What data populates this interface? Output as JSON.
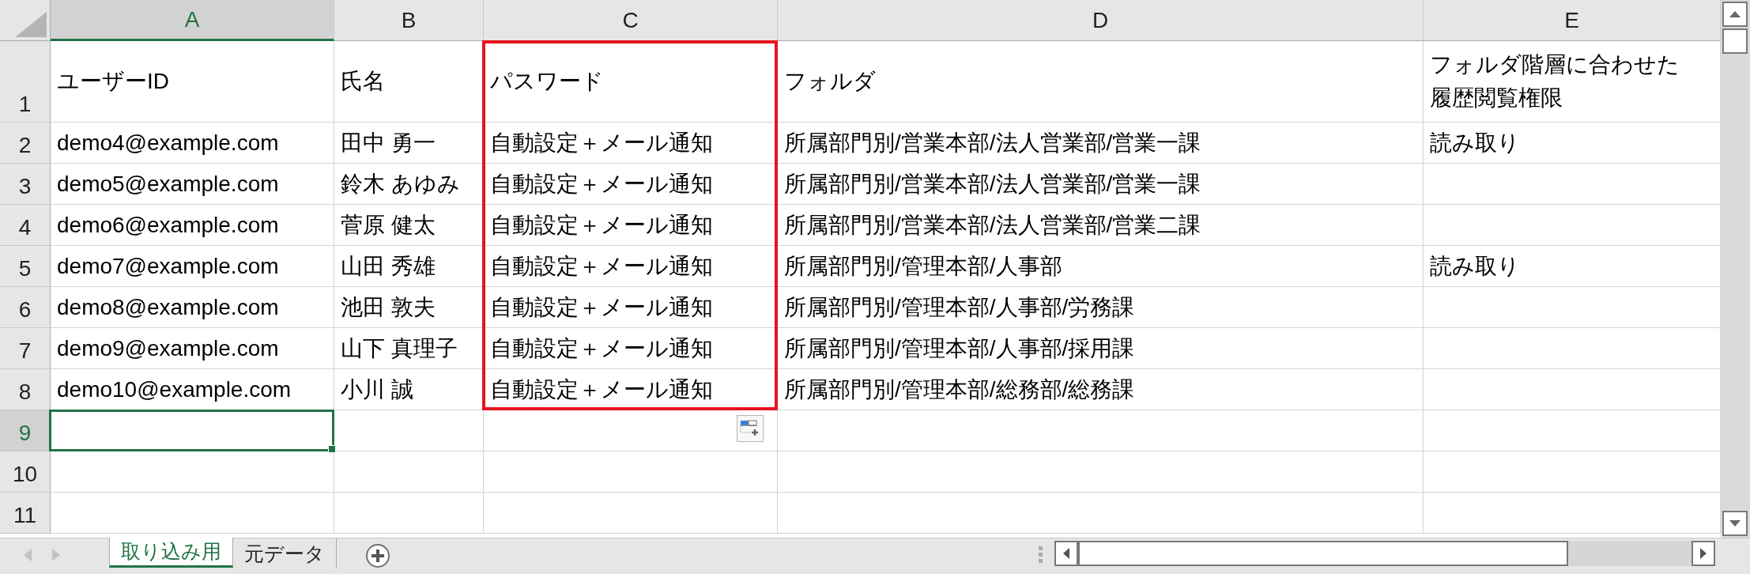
{
  "columns": [
    {
      "label": "A",
      "selected": true,
      "highlighted": false
    },
    {
      "label": "B",
      "selected": false,
      "highlighted": false
    },
    {
      "label": "C",
      "selected": false,
      "highlighted": true
    },
    {
      "label": "D",
      "selected": false,
      "highlighted": false
    },
    {
      "label": "E",
      "selected": false,
      "highlighted": false
    }
  ],
  "rows": [
    {
      "number": "1",
      "selected": false,
      "cells": [
        "ユーザーID",
        "氏名",
        "パスワード",
        "フォルダ",
        "フォルダ階層に合わせた履歴閲覧権限"
      ]
    },
    {
      "number": "2",
      "selected": false,
      "cells": [
        "demo4@example.com",
        "田中 勇一",
        "自動設定＋メール通知",
        "所属部門別/営業本部/法人営業部/営業一課",
        "読み取り"
      ]
    },
    {
      "number": "3",
      "selected": false,
      "cells": [
        "demo5@example.com",
        "鈴木 あゆみ",
        "自動設定＋メール通知",
        "所属部門別/営業本部/法人営業部/営業一課",
        null
      ]
    },
    {
      "number": "4",
      "selected": false,
      "cells": [
        "demo6@example.com",
        "菅原 健太",
        "自動設定＋メール通知",
        "所属部門別/営業本部/法人営業部/営業二課",
        null
      ]
    },
    {
      "number": "5",
      "selected": false,
      "cells": [
        "demo7@example.com",
        "山田 秀雄",
        "自動設定＋メール通知",
        "所属部門別/管理本部/人事部",
        "読み取り"
      ]
    },
    {
      "number": "6",
      "selected": false,
      "cells": [
        "demo8@example.com",
        "池田 敦夫",
        "自動設定＋メール通知",
        "所属部門別/管理本部/人事部/労務課",
        null
      ]
    },
    {
      "number": "7",
      "selected": false,
      "cells": [
        "demo9@example.com",
        "山下 真理子",
        "自動設定＋メール通知",
        "所属部門別/管理本部/人事部/採用課",
        null
      ]
    },
    {
      "number": "8",
      "selected": false,
      "cells": [
        "demo10@example.com",
        "小川 誠",
        "自動設定＋メール通知",
        "所属部門別/管理本部/総務部/総務課",
        null
      ]
    },
    {
      "number": "9",
      "selected": true
    },
    {
      "number": "10",
      "selected": false
    },
    {
      "number": "11",
      "selected": false
    }
  ],
  "sheet_tabs": [
    {
      "label": "取り込み用",
      "selected": true
    },
    {
      "label": "元データ",
      "selected": false
    }
  ]
}
